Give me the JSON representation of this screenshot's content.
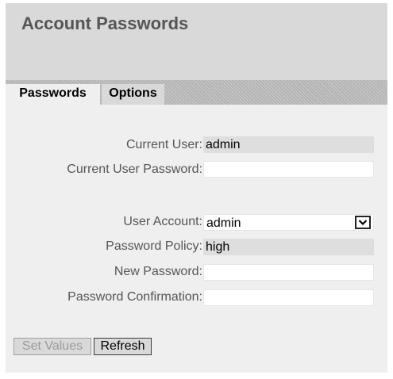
{
  "page_title": "Account Passwords",
  "tabs": [
    {
      "label": "Passwords",
      "active": true
    },
    {
      "label": "Options",
      "active": false
    }
  ],
  "form": {
    "current_user": {
      "label": "Current User:",
      "value": "admin"
    },
    "current_user_password": {
      "label": "Current User Password:",
      "value": ""
    },
    "user_account": {
      "label": "User Account:",
      "selected": "admin"
    },
    "password_policy": {
      "label": "Password Policy:",
      "value": "high"
    },
    "new_password": {
      "label": "New Password:",
      "value": ""
    },
    "password_confirmation": {
      "label": "Password Confirmation:",
      "value": ""
    }
  },
  "buttons": {
    "set_values": {
      "label": "Set Values",
      "enabled": false
    },
    "refresh": {
      "label": "Refresh",
      "enabled": true
    }
  },
  "icons": {
    "dropdown": "chevron-down-icon"
  },
  "colors": {
    "header_background": "#d9d9d9",
    "content_background": "#efefef",
    "title_text": "#555555",
    "label_text": "#555555",
    "readonly_field": "#dedede"
  }
}
